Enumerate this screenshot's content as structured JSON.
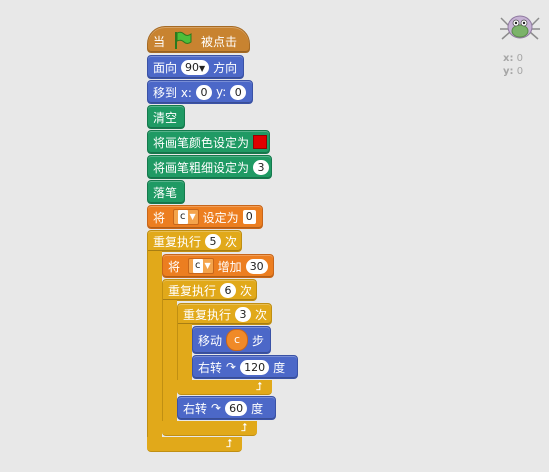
{
  "script": {
    "hat": {
      "prefix": "当",
      "suffix": "被点击",
      "flag_icon": "green-flag-icon"
    },
    "point_direction": {
      "label": "面向",
      "value": "90",
      "suffix": "方向"
    },
    "go_to": {
      "label": "移到 x:",
      "x": "0",
      "y_label": "y:",
      "y": "0"
    },
    "clear": {
      "label": "清空"
    },
    "set_pen_color": {
      "label": "将画笔颜色设定为",
      "color": "#e00000"
    },
    "set_pen_size": {
      "label": "将画笔粗细设定为",
      "value": "3"
    },
    "pen_down": {
      "label": "落笔"
    },
    "set_var": {
      "prefix": "将",
      "var": "c",
      "mid": "设定为",
      "value": "0"
    },
    "repeat1": {
      "prefix": "重复执行",
      "value": "5",
      "suffix": "次"
    },
    "change_var": {
      "prefix": "将",
      "var": "c",
      "mid": "增加",
      "value": "30"
    },
    "repeat2": {
      "prefix": "重复执行",
      "value": "6",
      "suffix": "次"
    },
    "repeat3": {
      "prefix": "重复执行",
      "value": "3",
      "suffix": "次"
    },
    "move": {
      "prefix": "移动",
      "reporter": "c",
      "suffix": "步"
    },
    "turn1": {
      "prefix": "右转",
      "value": "120",
      "suffix": "度"
    },
    "turn2": {
      "prefix": "右转",
      "value": "60",
      "suffix": "度"
    }
  },
  "sprite_info": {
    "x_label": "x:",
    "x": "0",
    "y_label": "y:",
    "y": "0",
    "thumbnail_icon": "bug-sprite-icon"
  }
}
